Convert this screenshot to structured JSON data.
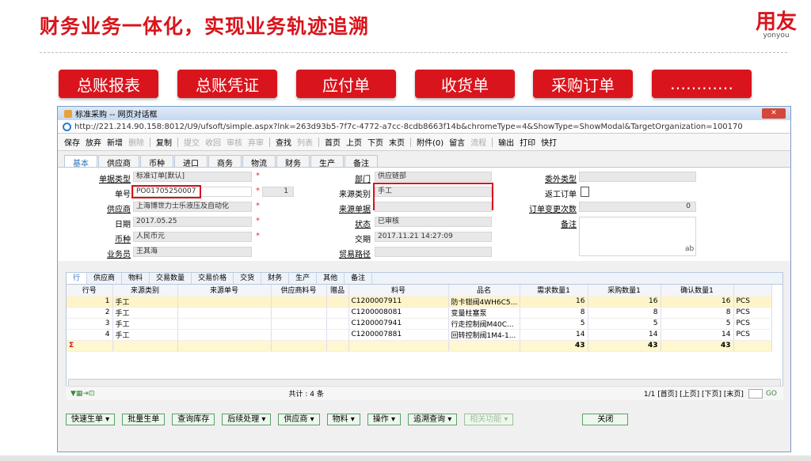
{
  "slide": {
    "title": "财务业务一体化，实现业务轨迹追溯",
    "logo": "用友",
    "logo_sub": "yonyou"
  },
  "nav_buttons": [
    "总账报表",
    "总账凭证",
    "应付单",
    "收货单",
    "采购订单",
    "…………"
  ],
  "window": {
    "title": "标准采购 -- 网页对话框",
    "url": "http://221.214.90.158:8012/U9/ufsoft/simple.aspx?lnk=263d93b5-7f7c-4772-a7cc-8cdb8663f14b&chromeType=4&ShowType=ShowModal&TargetOrganization=100170",
    "close": "✕"
  },
  "toolbar": {
    "items": [
      "保存",
      "放弃",
      "新增",
      "删除",
      "复制",
      "提交",
      "收回",
      "审核",
      "弃审",
      "查找",
      "列表",
      "首页",
      "上页",
      "下页",
      "末页",
      "附件(0)",
      "留言",
      "流程",
      "输出",
      "打印",
      "快打"
    ]
  },
  "form_tabs": [
    "基本",
    "供应商",
    "币种",
    "进口",
    "商务",
    "物流",
    "财务",
    "生产",
    "备注"
  ],
  "form": {
    "doc_type_label": "单据类型",
    "doc_type": "标准订单[默认]",
    "dept_label": "部门",
    "dept": "供应链部",
    "outsource_label": "委外类型",
    "order_no_label": "单号",
    "order_no": "PO01705250007",
    "order_no_seq": "1",
    "source_type_label": "来源类别",
    "source_type": "手工",
    "return_label": "返工订单",
    "supplier_label": "供应商",
    "supplier": "上海博世力士乐液压及自动化",
    "source_doc_label": "来源单据",
    "change_count_label": "订单变更次数",
    "change_count": "0",
    "date_label": "日期",
    "date": "2017.05.25",
    "status_label": "状态",
    "status": "已审核",
    "remark_label": "备注",
    "currency_label": "币种",
    "currency": "人民币元",
    "delivery_label": "交期",
    "delivery": "2017.11.21 14:27:09",
    "buyer_label": "业务员",
    "buyer": "王其海",
    "trade_label": "贸易路径",
    "ab": "ab"
  },
  "grid": {
    "tabs": [
      "行",
      "供应商",
      "物料",
      "交易数量",
      "交易价格",
      "交货",
      "财务",
      "生产",
      "其他",
      "备注"
    ],
    "headers": [
      "行号",
      "来源类别",
      "来源单号",
      "供应商料号",
      "赠品",
      "料号",
      "品名",
      "需求数量1",
      "采购数量1",
      "确认数量1",
      ""
    ],
    "rows": [
      [
        "1",
        "手工",
        "",
        "",
        "",
        "C1200007911",
        "防卡钳阀4WH6C5...",
        "16",
        "16",
        "16",
        "PCS"
      ],
      [
        "2",
        "手工",
        "",
        "",
        "",
        "C1200008081",
        "变量柱塞泵",
        "8",
        "8",
        "8",
        "PCS"
      ],
      [
        "3",
        "手工",
        "",
        "",
        "",
        "C1200007941",
        "行走控制阀M40C...",
        "5",
        "5",
        "5",
        "PCS"
      ],
      [
        "4",
        "手工",
        "",
        "",
        "",
        "C1200007881",
        "回转控制阀1M4-1...",
        "14",
        "14",
        "14",
        "PCS"
      ]
    ],
    "totals": [
      "43",
      "43",
      "43"
    ],
    "sigma": "Σ",
    "count": "共计 : 4 条",
    "pager": "1/1 [首页] [上页] [下页] [末页]",
    "go": "GO"
  },
  "bottom_buttons": [
    "快速生单 ▾",
    "批量生单",
    "查询库存",
    "后续处理 ▾",
    "供应商 ▾",
    "物料 ▾",
    "操作 ▾",
    "追溯查询 ▾",
    "相关功能 ▾",
    "关闭"
  ]
}
